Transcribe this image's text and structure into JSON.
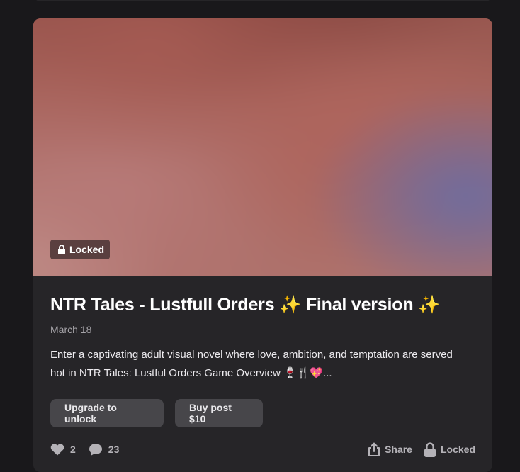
{
  "post": {
    "locked_badge": "Locked",
    "title": "NTR Tales - Lustfull Orders ✨ Final version ✨",
    "date": "March 18",
    "excerpt": "Enter a captivating adult visual novel where love, ambition, and temptation are served hot in NTR Tales: Lustful Orders Game Overview 🍷🍴💖...",
    "cover_icon": "blurred-cover-image"
  },
  "buttons": {
    "upgrade_label": "Upgrade to unlock",
    "buy_label": "Buy post $10"
  },
  "footer": {
    "likes_count": "2",
    "comments_count": "23",
    "share_label": "Share",
    "locked_label": "Locked"
  },
  "colors": {
    "page_bg": "#19181b",
    "card_bg": "#262528",
    "button_bg": "#47464a",
    "badge_bg": "#5a3f3f"
  }
}
